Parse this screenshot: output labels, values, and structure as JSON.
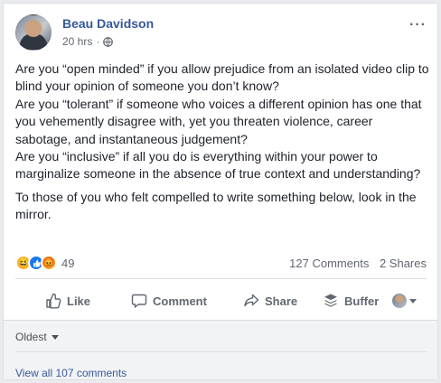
{
  "post": {
    "author": "Beau Davidson",
    "time": "20 hrs",
    "separator": "·",
    "more": "···",
    "paragraphs": [
      "Are you “open minded” if you allow prejudice from an isolated video clip to blind your opinion of someone you don’t know?\nAre you “tolerant” if someone who voices a different opinion has one that you vehemently disagree with, yet you threaten violence, career sabotage, and instantaneous judgement?\nAre you “inclusive” if all you do is everything within your power to marginalize someone in the absence of true context and understanding?",
      "To those of you who felt compelled to write something below, look in the mirror."
    ]
  },
  "stats": {
    "reaction_count": "49",
    "comments": "127 Comments",
    "shares": "2 Shares",
    "reaction_icons": [
      "haha-icon",
      "like-icon",
      "angry-icon"
    ]
  },
  "actions": {
    "like": "Like",
    "comment": "Comment",
    "share": "Share",
    "buffer": "Buffer"
  },
  "comments": {
    "sort": "Oldest",
    "view_all": "View all 107 comments"
  },
  "colors": {
    "link": "#365899",
    "muted": "#616770",
    "like_blue": "#1877f2"
  }
}
